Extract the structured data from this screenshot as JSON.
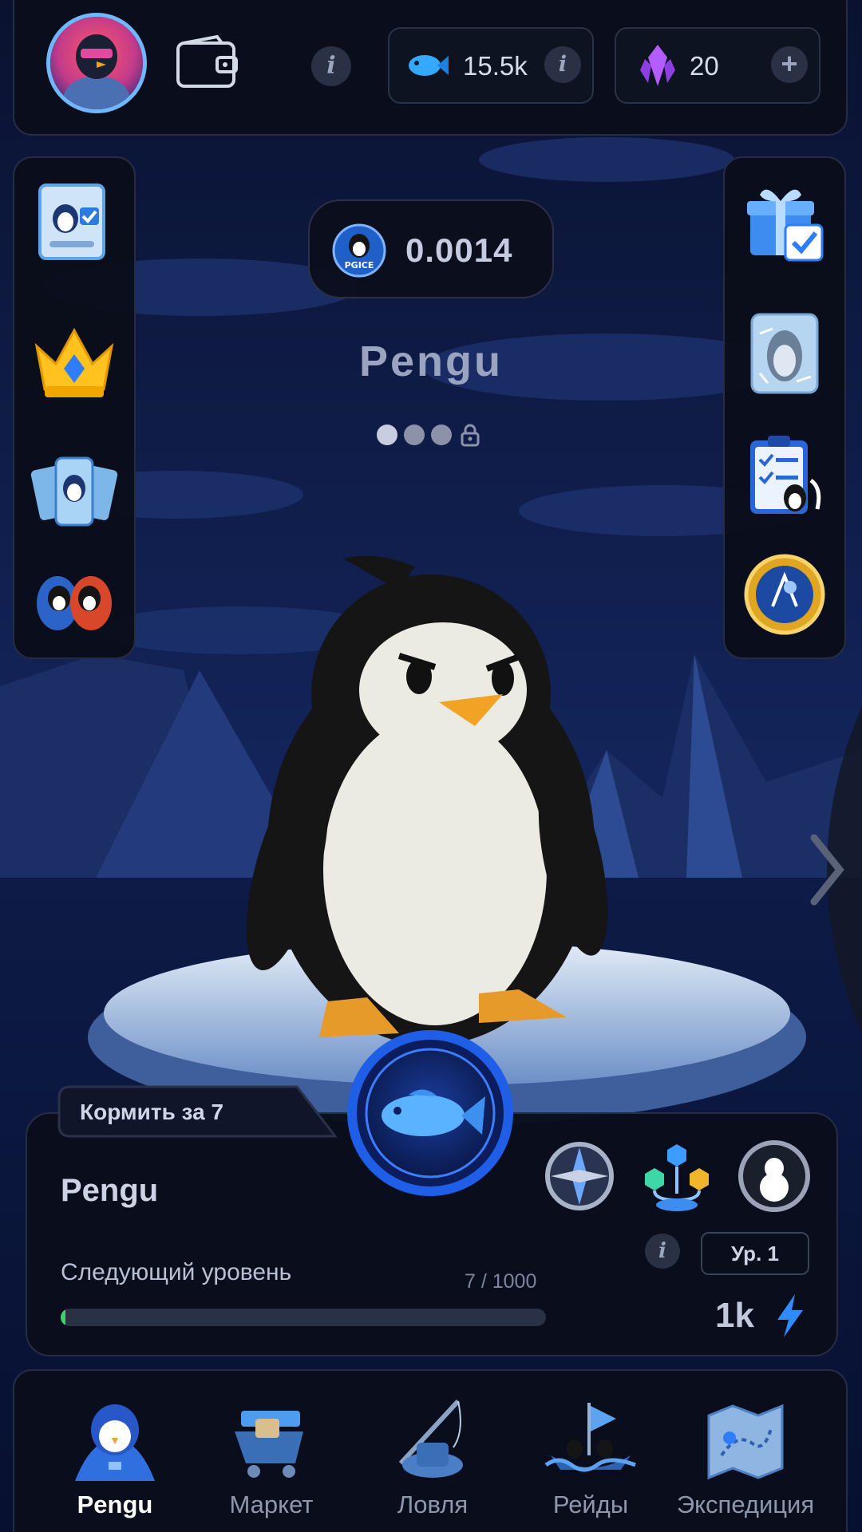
{
  "header": {
    "avatar_icon": "penguin-avatar-icon",
    "wallet_icon": "wallet-icon",
    "info_glyph": "i",
    "fish_balance": "15.5k",
    "fish_icon": "fish-currency-icon",
    "gem_balance": "20",
    "gem_icon": "purple-crystal-icon",
    "add_glyph": "+"
  },
  "left_sidebar": [
    {
      "name": "cards-collection-icon"
    },
    {
      "name": "crown-icon"
    },
    {
      "name": "penguin-cards-icon"
    },
    {
      "name": "battle-icon"
    }
  ],
  "right_sidebar": [
    {
      "name": "daily-gift-icon"
    },
    {
      "name": "frozen-penguin-icon"
    },
    {
      "name": "tasks-clipboard-icon"
    },
    {
      "name": "medal-icon"
    }
  ],
  "token": {
    "coin_label": "PGICE",
    "value": "0.0014"
  },
  "pet": {
    "name": "Pengu",
    "evolution_stage": 1,
    "evolution_total": 3
  },
  "feed": {
    "label": "Кормить за 7",
    "button_icon": "fish-feed-icon"
  },
  "level_panel": {
    "pet_name": "Pengu",
    "next_level_label": "Следующий уровень",
    "progress_text": "7 / 1000",
    "progress_fraction": 0.007,
    "level_badge": "Ур. 1",
    "energy_value": "1k",
    "energy_icon": "lightning-icon",
    "actions": [
      "compass-icon",
      "skill-tree-icon",
      "penguin-silhouette-icon"
    ]
  },
  "nav": {
    "items": [
      {
        "label": "Pengu",
        "icon": "pengu-nav-icon",
        "active": true
      },
      {
        "label": "Маркет",
        "icon": "market-nav-icon",
        "active": false
      },
      {
        "label": "Ловля",
        "icon": "fishing-nav-icon",
        "active": false
      },
      {
        "label": "Рейды",
        "icon": "raids-nav-icon",
        "active": false
      },
      {
        "label": "Экспедиция",
        "icon": "expedition-map-icon",
        "active": false
      }
    ]
  },
  "colors": {
    "panel_bg": "#0a0e1a",
    "accent_blue": "#2f7dff",
    "progress_green": "#38d66b",
    "sky_dark": "#0b1636"
  }
}
